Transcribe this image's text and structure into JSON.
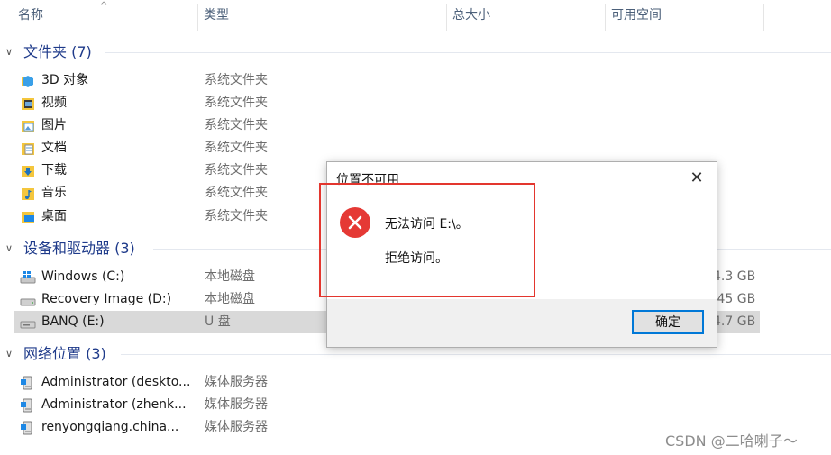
{
  "header": {
    "columns": [
      "名称",
      "类型",
      "总大小",
      "可用空间"
    ],
    "sort_indicator": "^"
  },
  "groups": {
    "folders": {
      "label": "文件夹 (7)",
      "chevron": "∨"
    },
    "drives": {
      "label": "设备和驱动器 (3)",
      "chevron": "∨"
    },
    "network": {
      "label": "网络位置 (3)",
      "chevron": "∨"
    }
  },
  "folders": [
    {
      "name": "3D 对象",
      "type": "系统文件夹",
      "icon": "3d-objects-folder-icon"
    },
    {
      "name": "视频",
      "type": "系统文件夹",
      "icon": "videos-folder-icon"
    },
    {
      "name": "图片",
      "type": "系统文件夹",
      "icon": "pictures-folder-icon"
    },
    {
      "name": "文档",
      "type": "系统文件夹",
      "icon": "documents-folder-icon"
    },
    {
      "name": "下载",
      "type": "系统文件夹",
      "icon": "downloads-folder-icon"
    },
    {
      "name": "音乐",
      "type": "系统文件夹",
      "icon": "music-folder-icon"
    },
    {
      "name": "桌面",
      "type": "系统文件夹",
      "icon": "desktop-folder-icon"
    }
  ],
  "drives": [
    {
      "name": "Windows (C:)",
      "type": "本地磁盘",
      "size": "4.3 GB",
      "icon": "windows-drive-icon"
    },
    {
      "name": "Recovery Image (D:)",
      "type": "本地磁盘",
      "size": ".45 GB",
      "icon": "hard-drive-icon"
    },
    {
      "name": "BANQ (E:)",
      "type": "U 盘",
      "size": "4.7 GB",
      "icon": "usb-drive-icon",
      "selected": true
    }
  ],
  "network": [
    {
      "name": "Administrator (deskto...",
      "type": "媒体服务器",
      "icon": "media-server-icon"
    },
    {
      "name": "Administrator (zhenk...",
      "type": "媒体服务器",
      "icon": "media-server-icon"
    },
    {
      "name": "renyongqiang.china...",
      "type": "媒体服务器",
      "icon": "media-server-icon"
    }
  ],
  "dialog": {
    "title": "位置不可用",
    "close": "✕",
    "message_1": "无法访问 E:\\。",
    "message_2": "拒绝访问。",
    "ok_button": "确定",
    "icon": "error-icon"
  },
  "watermark": "CSDN @二哈喇子～",
  "colors": {
    "accent": "#0078d7",
    "error": "#e53935",
    "highlight_box": "#e3362e",
    "selected_row": "#d9d9d9",
    "group_label": "#1e3a8a"
  }
}
